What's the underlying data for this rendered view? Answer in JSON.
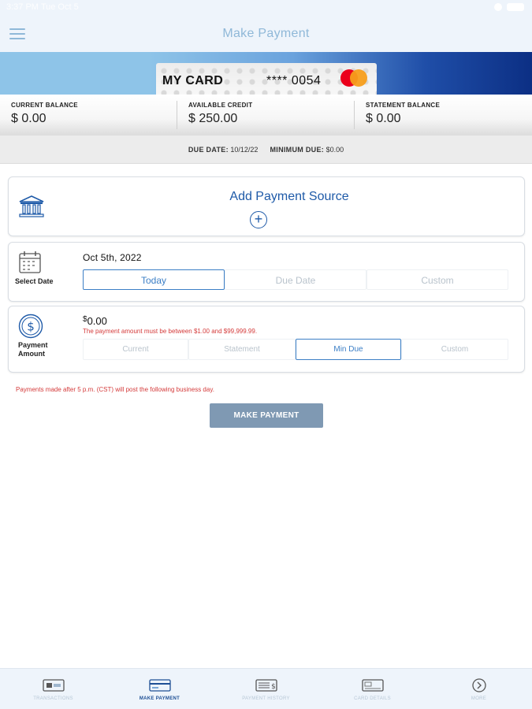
{
  "status_bar": {
    "time": "3:37 PM  Tue Oct 5"
  },
  "header": {
    "title": "Make Payment"
  },
  "card": {
    "name": "MY CARD",
    "number": "**** 0054"
  },
  "balances": [
    {
      "label": "CURRENT BALANCE",
      "value": "$ 0.00"
    },
    {
      "label": "AVAILABLE CREDIT",
      "value": "$ 250.00"
    },
    {
      "label": "STATEMENT BALANCE",
      "value": "$ 0.00"
    }
  ],
  "due": {
    "due_label": "DUE DATE:",
    "due_value": "10/12/22",
    "min_label": "MINIMUM DUE:",
    "min_value": "$0.00"
  },
  "payment_source": {
    "add_label": "Add Payment Source"
  },
  "select_date": {
    "label": "Select Date",
    "value": "Oct 5th, 2022",
    "options": [
      "Today",
      "Due Date",
      "Custom"
    ],
    "selected": "Today"
  },
  "payment_amount": {
    "label": "Payment Amount",
    "currency": "$",
    "value": "0.00",
    "error": "The payment amount must be between $1.00 and $99,999.99.",
    "options": [
      "Current",
      "Statement",
      "Min Due",
      "Custom"
    ],
    "selected": "Min Due"
  },
  "note": "Payments made after 5 p.m. (CST) will post the following business day.",
  "make_payment_button": "MAKE PAYMENT",
  "bottom_nav": [
    {
      "label": "TRANSACTIONS",
      "icon": "transactions-icon"
    },
    {
      "label": "MAKE PAYMENT",
      "icon": "payment-card-icon"
    },
    {
      "label": "PAYMENT HISTORY",
      "icon": "payment-history-icon"
    },
    {
      "label": "CARD DETAILS",
      "icon": "card-details-icon"
    },
    {
      "label": "MORE",
      "icon": "chevron-right-circle-icon"
    }
  ],
  "colors": {
    "accent": "#1e5aa8",
    "error": "#d43a3a",
    "button": "#7f99b3",
    "nav_active": "#1e4f95"
  }
}
